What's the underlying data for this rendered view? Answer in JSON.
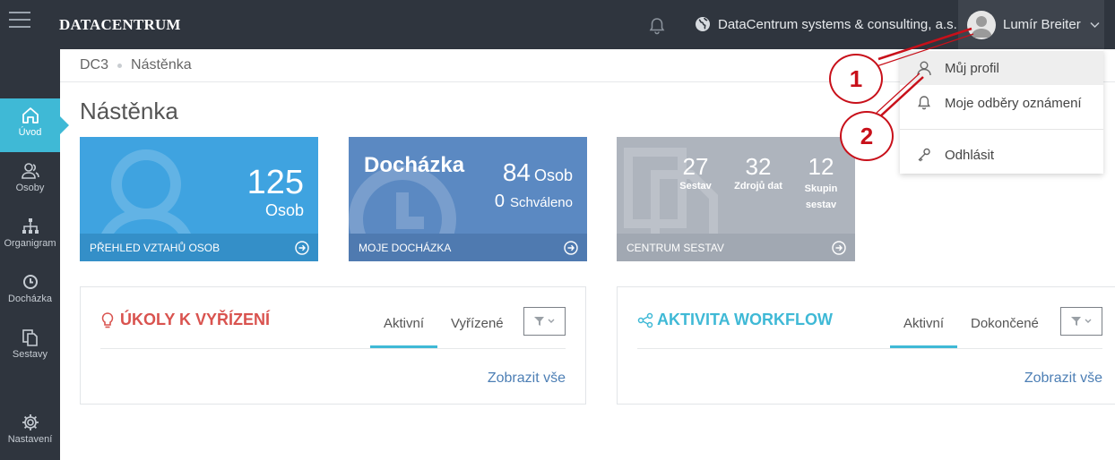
{
  "topbar": {
    "brand": "DATACENTRUM",
    "organization": "DataCentrum systems & consulting, a.s.",
    "user_name": "Lumír Breiter"
  },
  "sidebar": {
    "items": [
      {
        "label": "Úvod",
        "icon": "home-icon",
        "active": true
      },
      {
        "label": "Osoby",
        "icon": "users-icon"
      },
      {
        "label": "Organigram",
        "icon": "org-chart-icon"
      },
      {
        "label": "Docházka",
        "icon": "clock-icon"
      },
      {
        "label": "Sestavy",
        "icon": "documents-icon"
      },
      {
        "label": "Nastavení",
        "icon": "gear-icon"
      }
    ]
  },
  "breadcrumb": {
    "root": "DC3",
    "current": "Nástěnka"
  },
  "page_title": "Nástěnka",
  "tiles": {
    "people": {
      "value": "125",
      "unit": "Osob",
      "footer": "PŘEHLED VZTAHŮ OSOB",
      "color": "#3fa3e0"
    },
    "attendance": {
      "title": "Docházka",
      "value": "84",
      "unit": "Osob",
      "approved_value": "0",
      "approved_label": "Schváleno",
      "footer": "MOJE DOCHÁZKA",
      "color": "#5b89c2"
    },
    "reports": {
      "stats": [
        {
          "value": "27",
          "label": "Sestav"
        },
        {
          "value": "32",
          "label": "Zdrojů dat"
        },
        {
          "value": "12",
          "label": "Skupin sestav"
        }
      ],
      "footer": "CENTRUM SESTAV",
      "color": "#aeb4bd"
    }
  },
  "panels": {
    "tasks": {
      "title": "ÚKOLY K VYŘÍZENÍ",
      "tab_active": "Aktivní",
      "tab_other": "Vyřízené",
      "show_all": "Zobrazit vše",
      "accent": "#d9534f"
    },
    "workflow": {
      "title": "AKTIVITA WORKFLOW",
      "tab_active": "Aktivní",
      "tab_other": "Dokončené",
      "show_all": "Zobrazit vše",
      "accent": "#3fb9d6"
    }
  },
  "user_menu": {
    "items": [
      {
        "label": "Můj profil",
        "icon": "user-icon"
      },
      {
        "label": "Moje odběry oznámení",
        "icon": "bell-icon"
      },
      {
        "label": "Odhlásit",
        "icon": "key-icon"
      }
    ]
  },
  "callouts": [
    "1",
    "2"
  ]
}
